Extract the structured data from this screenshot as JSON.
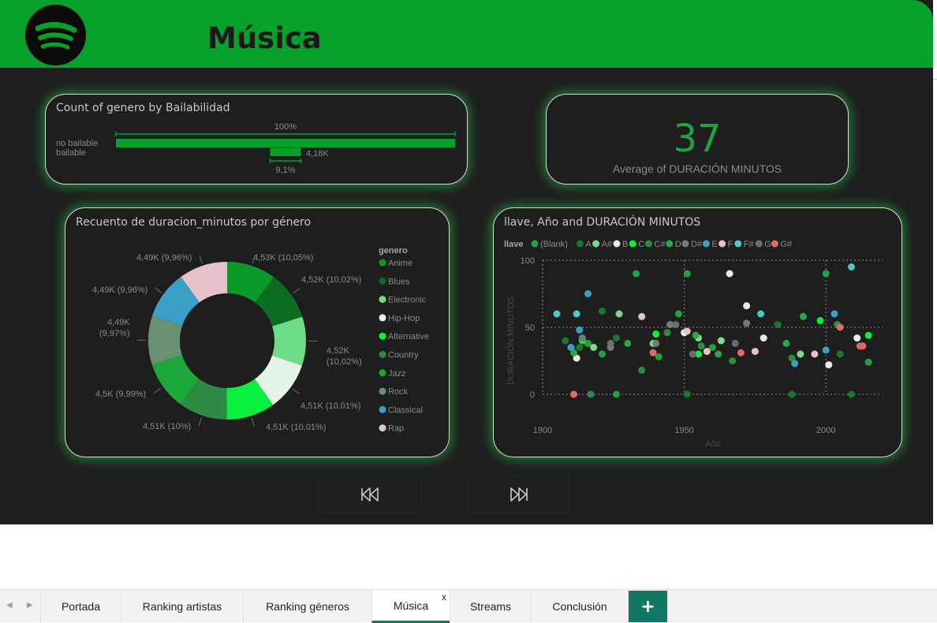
{
  "header": {
    "title": "Música",
    "logo_icon": "spotify-logo-icon",
    "color": "#07a02a"
  },
  "bar_card": {
    "title": "Count of genero by Bailabilidad",
    "categories": [
      "no bailable",
      "bailable"
    ],
    "top_pct_label": "100%",
    "value_label": "4,18K",
    "bottom_pct_label": "9,1%"
  },
  "kpi_card": {
    "value": "37",
    "label": "Average of DURACIÓN MINUTOS"
  },
  "donut_card": {
    "title": "Recuento de duracion_minutos por género",
    "legend_title": "genero",
    "slice_labels": [
      "4,53K (10,05%)",
      "4,52K (10,02%)",
      "4,52K",
      "(10,02%)",
      "4,51K (10,01%)",
      "4,51K (10,01%)",
      "4,51K (10%)",
      "4,5K (9,99%)",
      "4,49K",
      "(9,97%)",
      "4,49K (9,96%)",
      "4,49K (9,96%)"
    ]
  },
  "scatter_card": {
    "title": "llave, Año and DURACIÓN MINUTOS",
    "legend_title": "llave",
    "xlabel": "Año",
    "ylabel": "DURACIÓN MINUTOS",
    "x_ticks": [
      "1900",
      "1950",
      "2000"
    ],
    "y_ticks": [
      "100",
      "50",
      "0"
    ]
  },
  "nav": {
    "prev_icon": "skip-back-icon",
    "next_icon": "skip-forward-icon"
  },
  "tabs": {
    "items": [
      "Portada",
      "Ranking artistas",
      "Ranking géneros",
      "Música",
      "Streams",
      "Conclusión"
    ],
    "close_label": "x",
    "add_label": "+"
  },
  "chart_data": [
    {
      "type": "bar",
      "title": "Count of genero by Bailabilidad",
      "categories": [
        "no bailable",
        "bailable"
      ],
      "values": [
        45976,
        4180
      ],
      "percent_of_total": [
        100,
        9.1
      ],
      "color": "#07a02a"
    },
    {
      "type": "pie",
      "title": "Recuento de duracion_minutos por género",
      "categories": [
        "Anime",
        "Blues",
        "Electronic",
        "Hip-Hop",
        "Alternative",
        "Country",
        "Jazz",
        "Rock",
        "Classical",
        "Rap"
      ],
      "values": [
        4530,
        4520,
        4520,
        4510,
        4510,
        4510,
        4500,
        4490,
        4490,
        4490
      ],
      "percent": [
        10.05,
        10.02,
        10.02,
        10.01,
        10.01,
        10,
        9.99,
        9.97,
        9.96,
        9.96
      ],
      "colors": [
        "#0c9b2b",
        "#0a6d22",
        "#6fdc88",
        "#e2f5e6",
        "#09ef3d",
        "#2e8b45",
        "#1da83c",
        "#6b8f71",
        "#3aa0c6",
        "#e7c2c8"
      ],
      "legend": "right"
    },
    {
      "type": "scatter",
      "title": "llave, Año and DURACIÓN MINUTOS",
      "xlabel": "Año",
      "ylabel": "DURACIÓN MINUTOS",
      "xlim": [
        1900,
        2020
      ],
      "ylim": [
        0,
        100
      ],
      "grid": true,
      "legend": "top",
      "series": [
        {
          "name": "(Blank)",
          "color": "#1fa43d",
          "points": [
            [
              1916,
              38
            ],
            [
              1933,
              90
            ],
            [
              1948,
              60
            ],
            [
              1951,
              90
            ],
            [
              1960,
              35
            ],
            [
              2000,
              90
            ],
            [
              2015,
              24
            ],
            [
              1921,
              30
            ],
            [
              1941,
              28
            ],
            [
              1926,
              0
            ]
          ]
        },
        {
          "name": "A",
          "color": "#157a30",
          "points": [
            [
              1908,
              40
            ],
            [
              1921,
              62
            ],
            [
              1951,
              0
            ],
            [
              1988,
              0
            ],
            [
              2005,
              30
            ],
            [
              2009,
              0
            ],
            [
              1913,
              35
            ],
            [
              1926,
              42
            ],
            [
              1983,
              52
            ]
          ]
        },
        {
          "name": "A#",
          "color": "#7ed98f",
          "points": [
            [
              1918,
              35
            ],
            [
              1939,
              38
            ],
            [
              1955,
              42
            ],
            [
              1963,
              40
            ],
            [
              1991,
              30
            ],
            [
              1927,
              60
            ]
          ]
        },
        {
          "name": "B",
          "color": "#e8ece9",
          "points": [
            [
              1912,
              27
            ],
            [
              1966,
              90
            ],
            [
              1972,
              66
            ],
            [
              1978,
              42
            ],
            [
              2001,
              22
            ],
            [
              2011,
              42
            ],
            [
              1950,
              46
            ]
          ]
        },
        {
          "name": "C",
          "color": "#09ef3d",
          "points": [
            [
              1914,
              40
            ],
            [
              1955,
              30
            ],
            [
              1998,
              55
            ],
            [
              2015,
              44
            ],
            [
              1940,
              45
            ]
          ]
        },
        {
          "name": "C#",
          "color": "#2e8b45",
          "points": [
            [
              1917,
              0
            ],
            [
              1935,
              18
            ],
            [
              1956,
              36
            ],
            [
              1967,
              25
            ],
            [
              1988,
              27
            ],
            [
              2004,
              52
            ],
            [
              1944,
              46
            ]
          ]
        },
        {
          "name": "D",
          "color": "#27a844",
          "points": [
            [
              1911,
              31
            ],
            [
              1930,
              38
            ],
            [
              1954,
              44
            ],
            [
              1962,
              30
            ],
            [
              1986,
              38
            ],
            [
              1992,
              58
            ]
          ]
        },
        {
          "name": "D#",
          "color": "#6f7f73",
          "points": [
            [
              1914,
              42
            ],
            [
              1924,
              35
            ],
            [
              1940,
              38
            ],
            [
              1945,
              52
            ],
            [
              1972,
              53
            ]
          ]
        },
        {
          "name": "E",
          "color": "#3aa0c6",
          "points": [
            [
              1910,
              35
            ],
            [
              1913,
              48
            ],
            [
              1916,
              75
            ],
            [
              1989,
              23
            ],
            [
              2000,
              33
            ],
            [
              2003,
              60
            ]
          ]
        },
        {
          "name": "F",
          "color": "#e7c2c8",
          "points": [
            [
              1935,
              58
            ],
            [
              1951,
              47
            ],
            [
              1958,
              32
            ],
            [
              1975,
              32
            ],
            [
              1996,
              30
            ]
          ]
        },
        {
          "name": "F#",
          "color": "#4cc9c9",
          "points": [
            [
              1905,
              60
            ],
            [
              1912,
              60
            ],
            [
              1977,
              60
            ],
            [
              2009,
              95
            ]
          ]
        },
        {
          "name": "G",
          "color": "#6a6f6b",
          "points": [
            [
              1924,
              38
            ],
            [
              1947,
              52
            ],
            [
              1953,
              30
            ],
            [
              1968,
              38
            ]
          ]
        },
        {
          "name": "G#",
          "color": "#e06a6a",
          "points": [
            [
              1911,
              0
            ],
            [
              1939,
              31
            ],
            [
              1970,
              31
            ],
            [
              2005,
              50
            ],
            [
              2012,
              36
            ],
            [
              2013,
              36
            ]
          ]
        }
      ]
    }
  ]
}
